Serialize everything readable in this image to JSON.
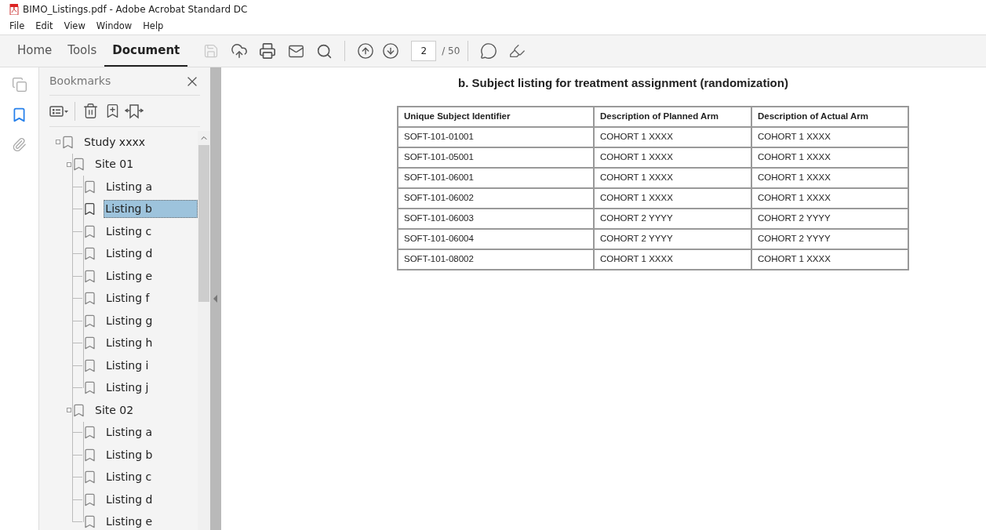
{
  "window": {
    "title": "BIMO_Listings.pdf - Adobe Acrobat Standard DC"
  },
  "menu": [
    "File",
    "Edit",
    "View",
    "Window",
    "Help"
  ],
  "tabs": [
    {
      "label": "Home",
      "selected": false
    },
    {
      "label": "Tools",
      "selected": false
    },
    {
      "label": "Document",
      "selected": true
    }
  ],
  "page_nav": {
    "value": "2",
    "total": "/ 50"
  },
  "bookmarks": {
    "title": "Bookmarks",
    "tree": [
      {
        "label": "Study xxxx",
        "selected": false,
        "expanded": true,
        "children": [
          {
            "label": "Site 01",
            "selected": false,
            "expanded": true,
            "children": [
              {
                "label": "Listing a",
                "selected": false
              },
              {
                "label": "Listing b",
                "selected": true
              },
              {
                "label": "Listing c",
                "selected": false
              },
              {
                "label": "Listing d",
                "selected": false
              },
              {
                "label": "Listing e",
                "selected": false
              },
              {
                "label": "Listing f",
                "selected": false
              },
              {
                "label": "Listing g",
                "selected": false
              },
              {
                "label": "Listing h",
                "selected": false
              },
              {
                "label": "Listing i",
                "selected": false
              },
              {
                "label": "Listing j",
                "selected": false
              }
            ]
          },
          {
            "label": "Site 02",
            "selected": false,
            "expanded": true,
            "children": [
              {
                "label": "Listing a",
                "selected": false
              },
              {
                "label": "Listing b",
                "selected": false
              },
              {
                "label": "Listing c",
                "selected": false
              },
              {
                "label": "Listing d",
                "selected": false
              },
              {
                "label": "Listing e",
                "selected": false
              }
            ]
          }
        ]
      }
    ]
  },
  "document": {
    "heading": "b. Subject listing for treatment assignment (randomization)",
    "table": {
      "columns": [
        "Unique Subject Identifier",
        "Description of Planned Arm",
        "Description of Actual Arm"
      ],
      "rows": [
        [
          "SOFT-101-01001",
          "COHORT 1 XXXX",
          "COHORT 1 XXXX"
        ],
        [
          "SOFT-101-05001",
          "COHORT 1 XXXX",
          "COHORT 1 XXXX"
        ],
        [
          "SOFT-101-06001",
          "COHORT 1 XXXX",
          "COHORT 1 XXXX"
        ],
        [
          "SOFT-101-06002",
          "COHORT 1 XXXX",
          "COHORT 1 XXXX"
        ],
        [
          "SOFT-101-06003",
          "COHORT 2 YYYY",
          "COHORT 2 YYYY"
        ],
        [
          "SOFT-101-06004",
          "COHORT 2 YYYY",
          "COHORT 2 YYYY"
        ],
        [
          "SOFT-101-08002",
          "COHORT 1 XXXX",
          "COHORT 1 XXXX"
        ]
      ]
    }
  }
}
